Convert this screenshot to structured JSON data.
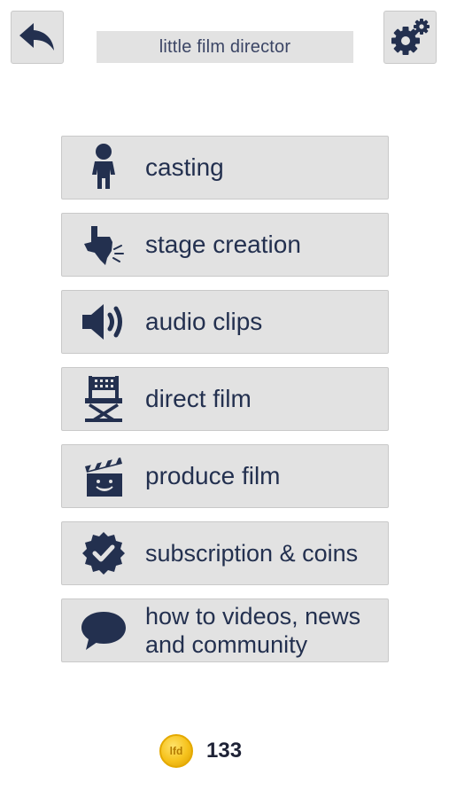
{
  "header": {
    "title": "little film director",
    "back_icon": "back-arrow-icon",
    "settings_icon": "gear-icon"
  },
  "menu": {
    "items": [
      {
        "label": "casting",
        "icon": "person-icon"
      },
      {
        "label": "stage creation",
        "icon": "texas-stage-icon"
      },
      {
        "label": "audio clips",
        "icon": "speaker-icon"
      },
      {
        "label": "direct film",
        "icon": "director-chair-icon"
      },
      {
        "label": "produce film",
        "icon": "clapperboard-icon"
      },
      {
        "label": "subscription & coins",
        "icon": "badge-check-icon"
      },
      {
        "label": "how to videos, news\nand community",
        "icon": "speech-bubble-icon"
      }
    ]
  },
  "coins": {
    "logo_text": "lfd",
    "count": "133"
  },
  "colors": {
    "icon": "#23304f",
    "button_bg": "#e2e2e2",
    "coin": "#f6c21c"
  }
}
